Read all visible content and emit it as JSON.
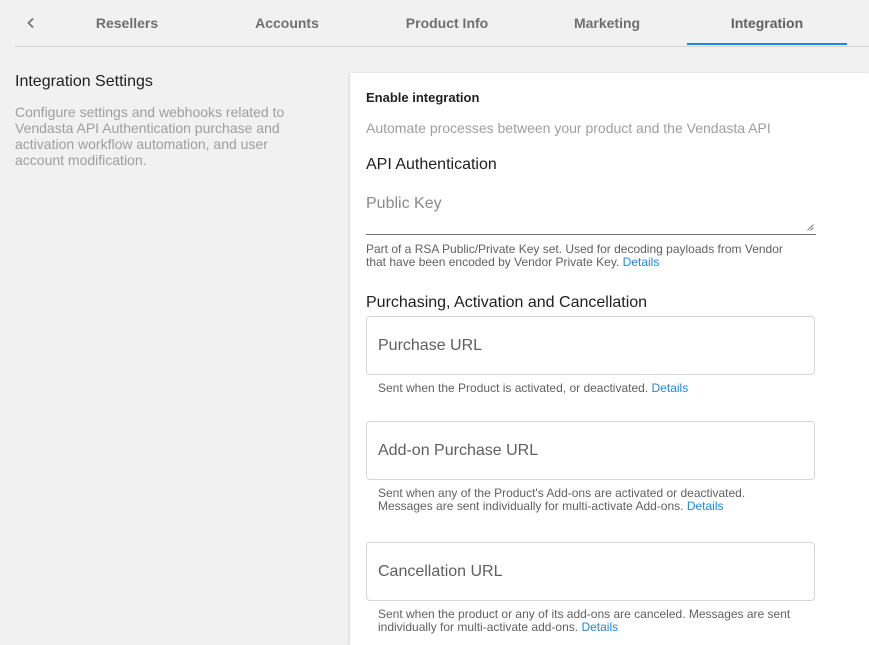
{
  "tabs": {
    "back_icon": "chevron-left-icon",
    "items": [
      {
        "label": "Resellers"
      },
      {
        "label": "Accounts"
      },
      {
        "label": "Product Info"
      },
      {
        "label": "Marketing"
      },
      {
        "label": "Integration"
      }
    ],
    "active": "Integration",
    "accent_color": "#1e88e5"
  },
  "settings": {
    "title": "Integration Settings",
    "description": "Configure settings and webhooks related to Vendasta API Authentication purchase and activation workflow automation, and user account modification."
  },
  "card": {
    "enable_label": "Enable integration",
    "enable_description": "Automate processes between your product and the Vendasta API",
    "api_auth_title": "API Authentication",
    "public_key": {
      "placeholder": "Public Key",
      "value": "",
      "hint": "Part of a RSA Public/Private Key set. Used for decoding payloads from Vendor that have been encoded by Vendor Private Key.",
      "details_link": "Details"
    },
    "purchasing_title": "Purchasing, Activation and Cancellation",
    "purchase_url": {
      "placeholder": "Purchase URL",
      "value": "",
      "hint": "Sent when the Product is activated, or deactivated.",
      "details_link": "Details"
    },
    "addon_purchase_url": {
      "placeholder": "Add-on Purchase URL",
      "value": "",
      "hint": "Sent when any of the Product's Add-ons are activated or deactivated. Messages are sent individually for multi-activate Add-ons.",
      "details_link": "Details"
    },
    "cancellation_url": {
      "placeholder": "Cancellation URL",
      "value": "",
      "hint": "Sent when the product or any of its add-ons are canceled. Messages are sent individually for multi-activate add-ons.",
      "details_link": "Details"
    }
  }
}
